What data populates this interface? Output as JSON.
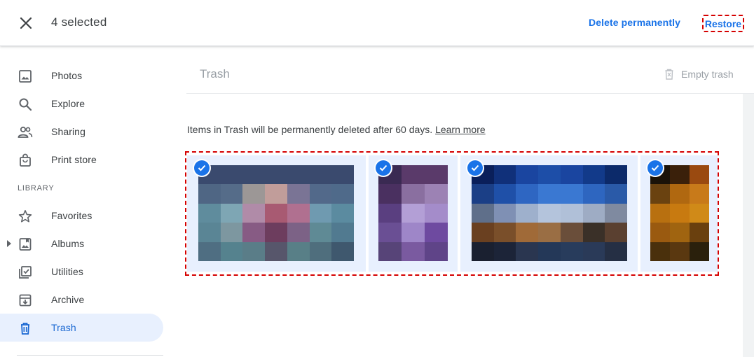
{
  "topbar": {
    "selected_text": "4 selected",
    "delete_label": "Delete permanently",
    "restore_label": "Restore"
  },
  "sidebar": {
    "items": [
      {
        "label": "Photos",
        "icon": "photo-icon"
      },
      {
        "label": "Explore",
        "icon": "search-icon"
      },
      {
        "label": "Sharing",
        "icon": "people-icon"
      },
      {
        "label": "Print store",
        "icon": "shopping-bag-icon"
      }
    ],
    "library_label": "LIBRARY",
    "library_items": [
      {
        "label": "Favorites",
        "icon": "star-icon"
      },
      {
        "label": "Albums",
        "icon": "album-icon"
      },
      {
        "label": "Utilities",
        "icon": "checkbox-icon"
      },
      {
        "label": "Archive",
        "icon": "archive-icon"
      },
      {
        "label": "Trash",
        "icon": "trash-icon",
        "active": true
      }
    ]
  },
  "main": {
    "title": "Trash",
    "empty_trash_label": "Empty trash",
    "notice": "Items in Trash will be permanently deleted after 60 days.",
    "learn_more": "Learn more"
  },
  "colors": {
    "accent": "#1a73e8",
    "selection_bg": "#e8f0fe",
    "highlight": "#d50000"
  },
  "photos": [
    {
      "selected": true,
      "cols": 7,
      "rows": 5,
      "palette": [
        "#3a4a6e",
        "#3a4a6e",
        "#3a4a6e",
        "#3a4a6e",
        "#3a4a6e",
        "#3a4a6e",
        "#3a4a6e",
        "#4f6684",
        "#556c89",
        "#9c9796",
        "#c19d9a",
        "#7a7495",
        "#52698a",
        "#4f6a8a",
        "#5f8c9d",
        "#7ea6b4",
        "#b08ba8",
        "#a85a72",
        "#b07090",
        "#6f9ab0",
        "#5b8ba0",
        "#5a8595",
        "#7d97a0",
        "#875b84",
        "#6d3d5e",
        "#7c6286",
        "#5f8a95",
        "#517a90",
        "#4f6e82",
        "#55828e",
        "#5a7d88",
        "#57566b",
        "#587f87",
        "#4f6e7d",
        "#3f586e"
      ]
    },
    {
      "selected": true,
      "cols": 3,
      "rows": 5,
      "palette": [
        "#3a2a52",
        "#5a3a6a",
        "#5a3a6a",
        "#4a3060",
        "#8a6fa0",
        "#9c82b4",
        "#5a3f80",
        "#b39fd6",
        "#a48cca",
        "#6a4f94",
        "#9e86c8",
        "#6e4aa0",
        "#574478",
        "#7a5aa0",
        "#5f4488"
      ]
    },
    {
      "selected": true,
      "cols": 7,
      "rows": 5,
      "palette": [
        "#0a1f5a",
        "#10307a",
        "#1a45a0",
        "#1d4ea8",
        "#1a45a0",
        "#123a8a",
        "#0c2a6a",
        "#1b3f86",
        "#1f50a8",
        "#2e66c2",
        "#3a78d2",
        "#3a78d2",
        "#2e66c0",
        "#2a5aa8",
        "#5f6f8a",
        "#7f90b4",
        "#9eb0cc",
        "#b4c4dc",
        "#b0c0d8",
        "#9eacc4",
        "#7f8aa0",
        "#6a4020",
        "#7a4f2a",
        "#a06a38",
        "#9a6e44",
        "#6a4e3a",
        "#3a3028",
        "#5a4030",
        "#1a2030",
        "#1c2438",
        "#2a3650",
        "#243858",
        "#283c5c",
        "#2a3a58",
        "#252f44"
      ]
    },
    {
      "selected": true,
      "cols": 3,
      "rows": 5,
      "palette": [
        "#1a1208",
        "#3a200a",
        "#9a4a10",
        "#6a4210",
        "#b06810",
        "#c87a1a",
        "#b87010",
        "#c87a10",
        "#d08a18",
        "#9a5a10",
        "#a06410",
        "#6a400e",
        "#4a300c",
        "#5a3810",
        "#2a200c"
      ]
    }
  ]
}
